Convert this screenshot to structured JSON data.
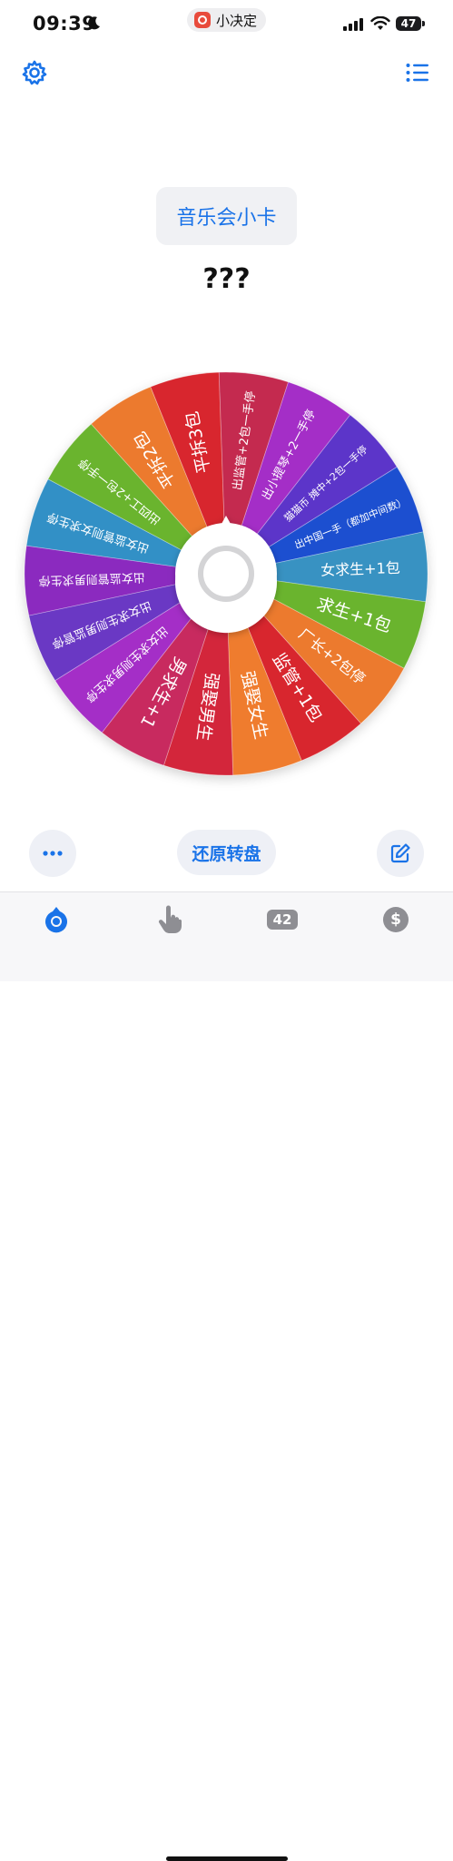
{
  "status_bar": {
    "time": "09:39",
    "app_name": "小决定",
    "battery": "47"
  },
  "title_button": "音乐会小卡",
  "result": "???",
  "wheel": {
    "segments": [
      {
        "label": "出女监管则男求生停",
        "color": "#8b2bbf"
      },
      {
        "label": "出女监管则女求生停",
        "color": "#3390c6"
      },
      {
        "label": "出四工+2包一手停",
        "color": "#6ab42f"
      },
      {
        "label": "平拆2包",
        "color": "#ec7a2e"
      },
      {
        "label": "平拆3包",
        "color": "#d8282f"
      },
      {
        "label": "出监管+2包一手停",
        "color": "#c4294f"
      },
      {
        "label": "出小提琴+2一手停",
        "color": "#a42ec7"
      },
      {
        "label": "猫猫币 摊中+2包一手停",
        "color": "#5c36c9"
      },
      {
        "label": "出中国一手（都加中间数）",
        "color": "#1f4fd0"
      },
      {
        "label": "女求生+1包",
        "color": "#3792c2"
      },
      {
        "label": "求生+1包",
        "color": "#6ab42f"
      },
      {
        "label": "厂长+2包停",
        "color": "#ec7a2e"
      },
      {
        "label": "监管+1包",
        "color": "#d8282f"
      },
      {
        "label": "强娶女生",
        "color": "#ef7b2e"
      },
      {
        "label": "强娶男生",
        "color": "#d3283a"
      },
      {
        "label": "男求生+1",
        "color": "#c82a5e"
      },
      {
        "label": "出女求生则男求生停",
        "color": "#a42ec7"
      },
      {
        "label": "出女求生则男监管停",
        "color": "#6a37c4"
      }
    ]
  },
  "reset_button": "还原转盘",
  "tab_bar": {
    "count": "42",
    "currency": "$"
  },
  "icons": {
    "settings": "gear-icon",
    "list": "list-icon",
    "more": "ellipsis-icon",
    "edit": "edit-icon",
    "tab_wheel": "wheel-icon",
    "tab_tap": "hand-pointer-icon"
  },
  "colors": {
    "accent": "#1a73e8"
  }
}
